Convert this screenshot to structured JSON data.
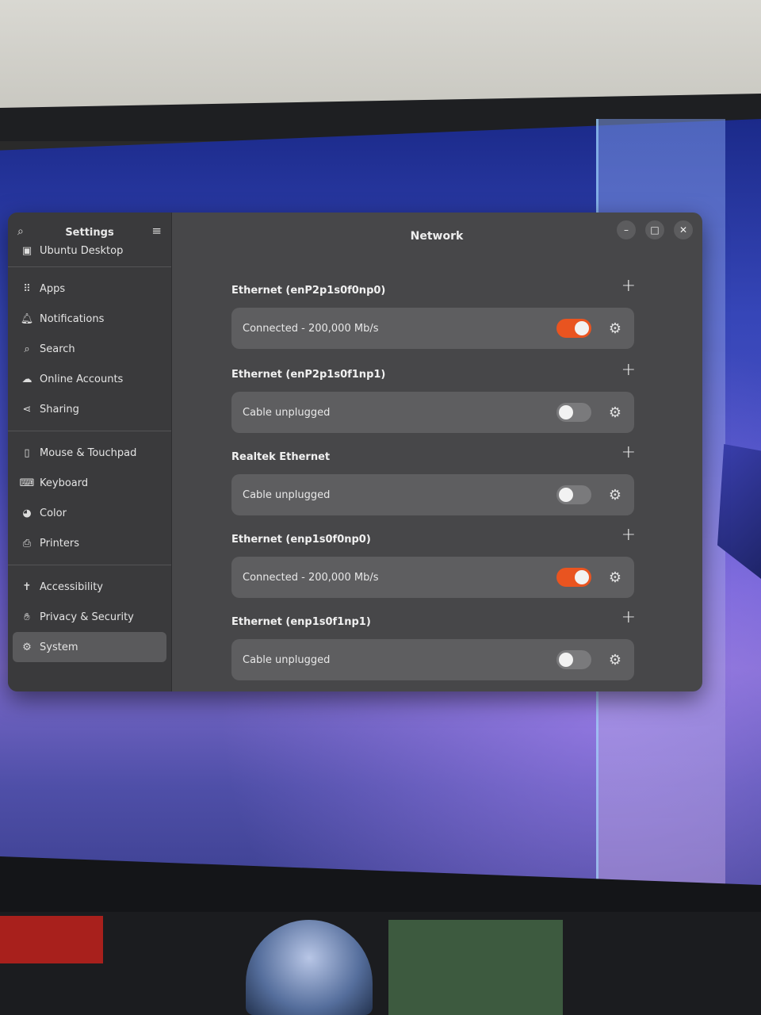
{
  "window": {
    "sidebar_title": "Settings",
    "content_title": "Network",
    "controls": {
      "minimize": "–",
      "maximize": "□",
      "close": "✕"
    }
  },
  "sidebar": {
    "partial_item": {
      "label": "Ubuntu Desktop",
      "icon": "display-icon"
    },
    "groups": [
      [
        {
          "label": "Apps",
          "icon": "apps-grid-icon"
        },
        {
          "label": "Notifications",
          "icon": "bell-icon"
        },
        {
          "label": "Search",
          "icon": "search-icon"
        },
        {
          "label": "Online Accounts",
          "icon": "cloud-icon"
        },
        {
          "label": "Sharing",
          "icon": "share-icon"
        }
      ],
      [
        {
          "label": "Mouse & Touchpad",
          "icon": "mouse-icon"
        },
        {
          "label": "Keyboard",
          "icon": "keyboard-icon"
        },
        {
          "label": "Color",
          "icon": "color-icon"
        },
        {
          "label": "Printers",
          "icon": "printer-icon"
        }
      ],
      [
        {
          "label": "Accessibility",
          "icon": "accessibility-icon"
        },
        {
          "label": "Privacy & Security",
          "icon": "privacy-icon"
        },
        {
          "label": "System",
          "icon": "gear-icon",
          "active": true
        }
      ]
    ]
  },
  "network": {
    "sections": [
      {
        "title": "Ethernet (enP2p1s0f0np0)",
        "status": "Connected - 200,000 Mb/s",
        "enabled": true
      },
      {
        "title": "Ethernet (enP2p1s0f1np1)",
        "status": "Cable unplugged",
        "enabled": false
      },
      {
        "title": "Realtek Ethernet",
        "status": "Cable unplugged",
        "enabled": false
      },
      {
        "title": "Ethernet (enp1s0f0np0)",
        "status": "Connected - 200,000 Mb/s",
        "enabled": true
      },
      {
        "title": "Ethernet (enp1s0f1np1)",
        "status": "Cable unplugged",
        "enabled": false
      }
    ]
  },
  "colors": {
    "accent": "#e95420",
    "window_bg": "#474749",
    "sidebar_bg": "#3a3a3c",
    "row_bg": "#5e5e60"
  }
}
